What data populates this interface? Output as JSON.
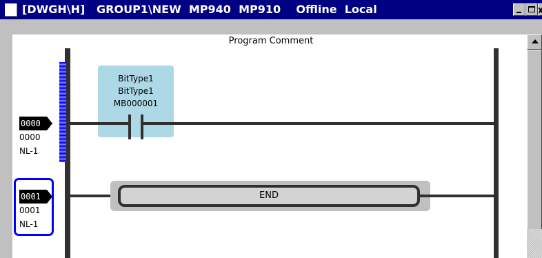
{
  "window": {
    "title": "[DWGH\\H]   GROUP1\\NEW  MP940  MP910    Offline  Local",
    "buttons": [
      "minimize",
      "maximize",
      "close"
    ],
    "title_bar_color": "#000082"
  },
  "ladder": {
    "program_comment": "Program Comment",
    "rows": [
      {
        "tag": "0000",
        "number": "0000",
        "net": "NL-1"
      },
      {
        "tag": "0001",
        "number": "0001",
        "net": "NL-1"
      }
    ],
    "contact": {
      "comment1": "BitType1",
      "comment2": "BitType1",
      "address": "MB000001",
      "fill_color": "#add8e6"
    },
    "end_instruction": "END",
    "selection_color": "#0000ff"
  },
  "icons": [
    "window-system-icon",
    "minimize-icon",
    "maximize-icon",
    "close-icon",
    "scroll-up-arrow-icon",
    "contact-no-icon",
    "row-pointer-icon"
  ]
}
